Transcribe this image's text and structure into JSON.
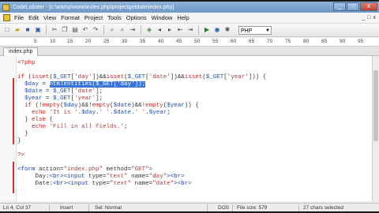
{
  "window": {
    "title": "CodeLobster - [c:\\wamp\\www\\index.php\\projectgetdate\\index.php]",
    "buttons": [
      "_",
      "□",
      "X"
    ]
  },
  "menubar": {
    "items": [
      "File",
      "Edit",
      "View",
      "Format",
      "Project",
      "Tools",
      "Options",
      "Window",
      "Help"
    ],
    "right": [
      "_",
      "□",
      "x"
    ]
  },
  "toolbar": {
    "language": "PHP"
  },
  "ruler": {
    "numbers": [
      "5",
      "10",
      "15",
      "20",
      "25",
      "30",
      "35",
      "40",
      "45",
      "50",
      "55",
      "60",
      "65",
      "70",
      "75",
      "80",
      "85",
      "90",
      "95"
    ]
  },
  "tabs": [
    {
      "label": "index.php"
    }
  ],
  "code": {
    "lines": [
      "<?php",
      "",
      "if (isset($_GET['day'])&&isset($_GET['date'])&&isset($_GET['year'])) {",
      "  $day = htmlentities($_GET['day']);",
      "  $date = $_GET['date'];",
      "  $year = $_GET['year'];",
      "  if (!empty($day)&&!empty($date)&&!empty($year)) {",
      "    echo 'It is '.$day.' '.$date.' '.$year;",
      "  } else {",
      "    echo 'Fill in all fields.';",
      "  }",
      "}",
      "",
      "?>",
      "",
      "<form action=\"index.php\" method=\"GET\">",
      "     Day:<br><input type=\"text\" name=\"day\"><br>",
      "     Date:<br><input type=\"text\" name=\"date\"><br>"
    ],
    "selected_text": "htmlentities($_GET['day']);"
  },
  "statusbar": {
    "position": "Ln 4, Col 37",
    "mode": "Insert",
    "selection": "Sel: Normal",
    "encoding": "DOS",
    "file_size": "File size: 579",
    "selected_chars": "27 chars selected"
  },
  "colors": {
    "keyword": "#d02020",
    "variable": "#2050b0",
    "selection": "#3874d8",
    "titlebar": "#6f98c6"
  }
}
